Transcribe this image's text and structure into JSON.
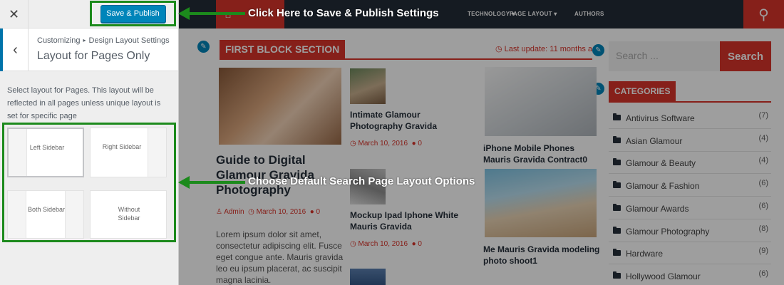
{
  "customizer": {
    "close_glyph": "✕",
    "save_label": "Save & Publish",
    "back_glyph": "‹",
    "breadcrumb_root": "Customizing",
    "breadcrumb_sep": "▸",
    "breadcrumb_section": "Design Layout Settings",
    "section_title": "Layout for Pages Only",
    "description": "Select layout for Pages. This layout will be reflected in all pages unless unique layout is set for specific page",
    "layouts": {
      "left_sidebar": "Left Sidebar",
      "right_sidebar": "Right Sidebar",
      "both_sidebar": "Both Sidebar",
      "without_sidebar": "Without Sidebar"
    }
  },
  "annotations": {
    "save_note": "Click Here to Save & Publish Settings",
    "layout_note": "Choose Default Search Page Layout Options"
  },
  "site": {
    "nav": [
      "TECHNOLOGY",
      "PAGE LAYOUT",
      "AUTHORS"
    ],
    "block_title": "FIRST BLOCK SECTION",
    "last_update": "Last update: 11 months a",
    "search_placeholder": "Search ...",
    "search_button": "Search",
    "main_post": {
      "title": "Guide to Digital Glamour Gravida Photography",
      "author": "Admin",
      "date": "March 10, 2016",
      "comments": "0",
      "excerpt": "Lorem ipsum dolor sit amet, consectetur adipiscing elit. Fusce eget congue ante. Mauris gravida leo eu ipsum placerat, ac suscipit magna lacinia."
    },
    "side_posts": [
      {
        "title": "Intimate Glamour Photography Gravida",
        "date": "March 10, 2016",
        "comments": "0"
      },
      {
        "title": "Mockup Ipad Iphone White Mauris Gravida",
        "date": "March 10, 2016",
        "comments": "0"
      }
    ],
    "right_posts": [
      {
        "title": "iPhone Mobile Phones Mauris Gravida Contract0"
      },
      {
        "title": "Me Mauris Gravida modeling photo shoot1"
      }
    ],
    "categories_title": "CATEGORIES",
    "categories": [
      {
        "name": "Antivirus Software",
        "count": "(7)"
      },
      {
        "name": "Asian Glamour",
        "count": "(4)"
      },
      {
        "name": "Glamour & Beauty",
        "count": "(4)"
      },
      {
        "name": "Glamour & Fashion",
        "count": "(6)"
      },
      {
        "name": "Glamour Awards",
        "count": "(6)"
      },
      {
        "name": "Glamour Photography",
        "count": "(8)"
      },
      {
        "name": "Hardware",
        "count": "(9)"
      },
      {
        "name": "Hollywood Glamour",
        "count": "(6)"
      }
    ]
  },
  "colors": {
    "accent_red": "#d9342b",
    "annotation_green": "#1c8a1c",
    "wp_blue": "#0085ba",
    "nav_dark": "#232c37"
  }
}
